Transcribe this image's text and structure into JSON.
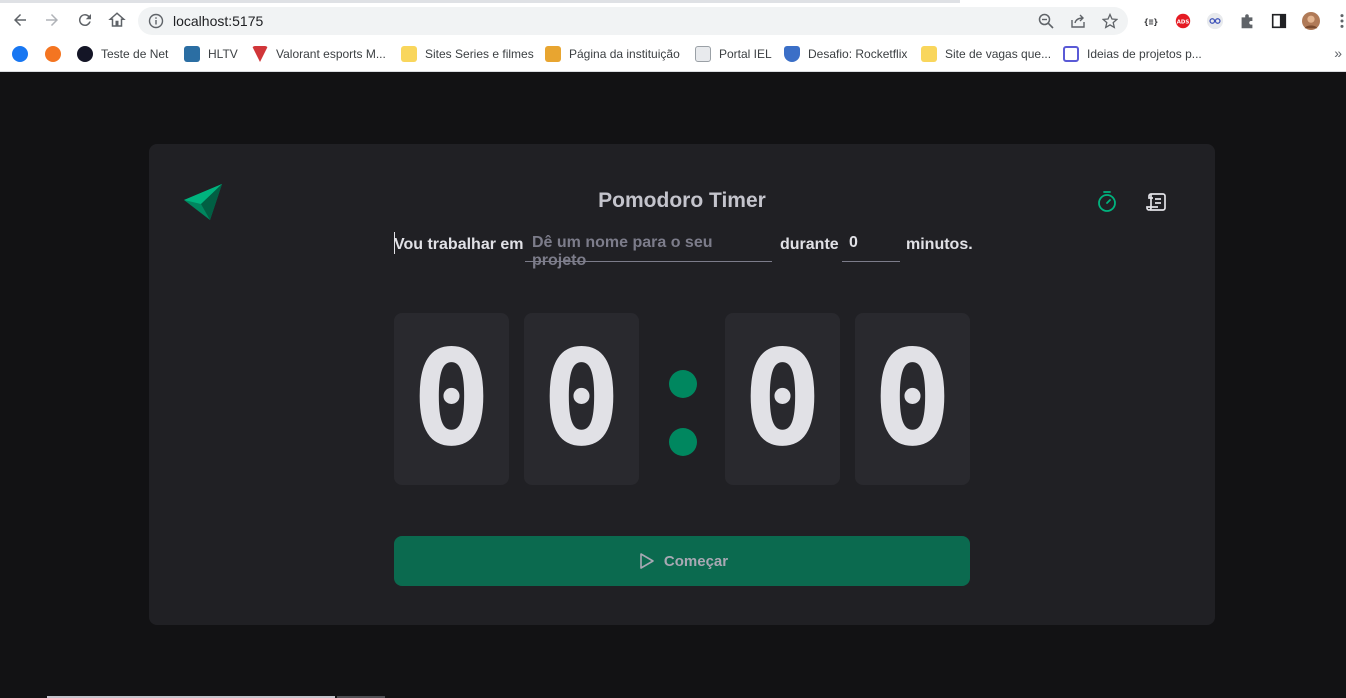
{
  "browser": {
    "url": "localhost:5175",
    "bookmarks": [
      {
        "label": "",
        "icon": "facebook-icon",
        "color": "#1877f2"
      },
      {
        "label": "",
        "icon": "crunchyroll-icon",
        "color": "#f47521"
      },
      {
        "label": "Teste de Net",
        "icon": "speedtest-icon",
        "color": "#141526"
      },
      {
        "label": "HLTV",
        "icon": "hltv-icon",
        "color": "#2b6ea3"
      },
      {
        "label": "Valorant esports M...",
        "icon": "valorant-icon",
        "color": "#d13639"
      },
      {
        "label": "Sites Series e filmes",
        "icon": "folder-icon",
        "color": "#f9d65c"
      },
      {
        "label": "Página da instituição",
        "icon": "pencil-icon",
        "color": "#e8a530"
      },
      {
        "label": "Portal IEL",
        "icon": "page-icon",
        "color": "#9aa0a6"
      },
      {
        "label": "Desafio: Rocketflix",
        "icon": "shield-icon",
        "color": "#3b6fc7"
      },
      {
        "label": "Site de vagas que...",
        "icon": "folder-icon",
        "color": "#f9d65c"
      },
      {
        "label": "Ideias de projetos p...",
        "icon": "ideas-icon",
        "color": "#5a5ad6"
      }
    ],
    "more_label": "»"
  },
  "app": {
    "title": "Pomodoro Timer",
    "form": {
      "prefix": "Vou trabalhar em",
      "task_placeholder": "Dê um nome para o seu projeto",
      "middle": "durante",
      "minutes_value": "0",
      "suffix": "minutos."
    },
    "timer": {
      "minutes_tens": "0",
      "minutes_units": "0",
      "seconds_tens": "0",
      "seconds_units": "0"
    },
    "start_label": "Começar",
    "colors": {
      "accent": "#00875f",
      "button": "#0b6a4f",
      "card": "#202024",
      "background": "#121214"
    }
  }
}
